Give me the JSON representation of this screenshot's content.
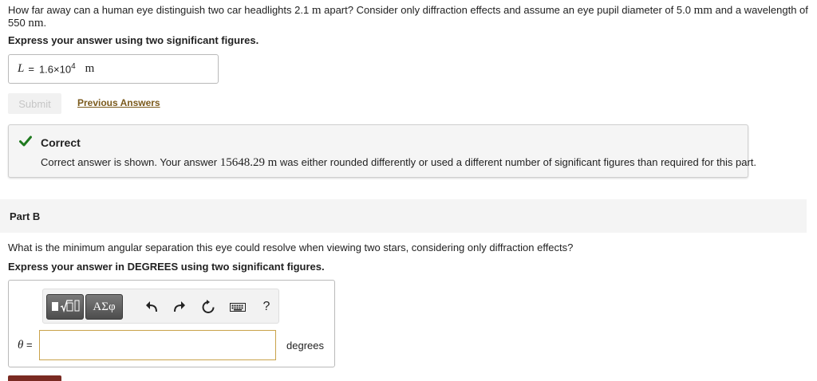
{
  "partA": {
    "question_pre": "How far away can a human eye distinguish two car headlights 2.1 ",
    "unit_m1": "m",
    "question_mid": " apart? Consider only diffraction effects and assume an eye pupil diameter of 5.0 ",
    "unit_mm": "mm",
    "question_post": " and a wavelength of 550 ",
    "unit_nm": "nm",
    "question_end": ".",
    "instruction": "Express your answer using two significant figures.",
    "answer": {
      "variable": "L",
      "equals": "=",
      "mantissa": "1.6×10",
      "exponent": "4",
      "unit": "m"
    },
    "submit_label": "Submit",
    "previous_answers_label": "Previous Answers",
    "feedback": {
      "title": "Correct",
      "msg_pre": "Correct answer is shown. Your answer ",
      "user_answer": "15648.29",
      "user_unit": "m",
      "msg_post": " was either rounded differently or used a different number of significant figures than required for this part.",
      "accent": "#1f7a1f"
    }
  },
  "partB": {
    "header": "Part B",
    "question": "What is the minimum angular separation this eye could resolve when viewing two stars, considering only diffraction effects?",
    "instruction": "Express your answer in DEGREES using two significant figures.",
    "toolbar": {
      "templates_icon": "templates-icon",
      "symbols_label": "ΑΣφ",
      "help_label": "?"
    },
    "input": {
      "variable": "θ",
      "equals": "=",
      "value": "",
      "unit": "degrees"
    }
  },
  "colors": {
    "link": "#7b5a1c",
    "input_border": "#c9a24a",
    "bottom_button": "#7a2a22"
  }
}
